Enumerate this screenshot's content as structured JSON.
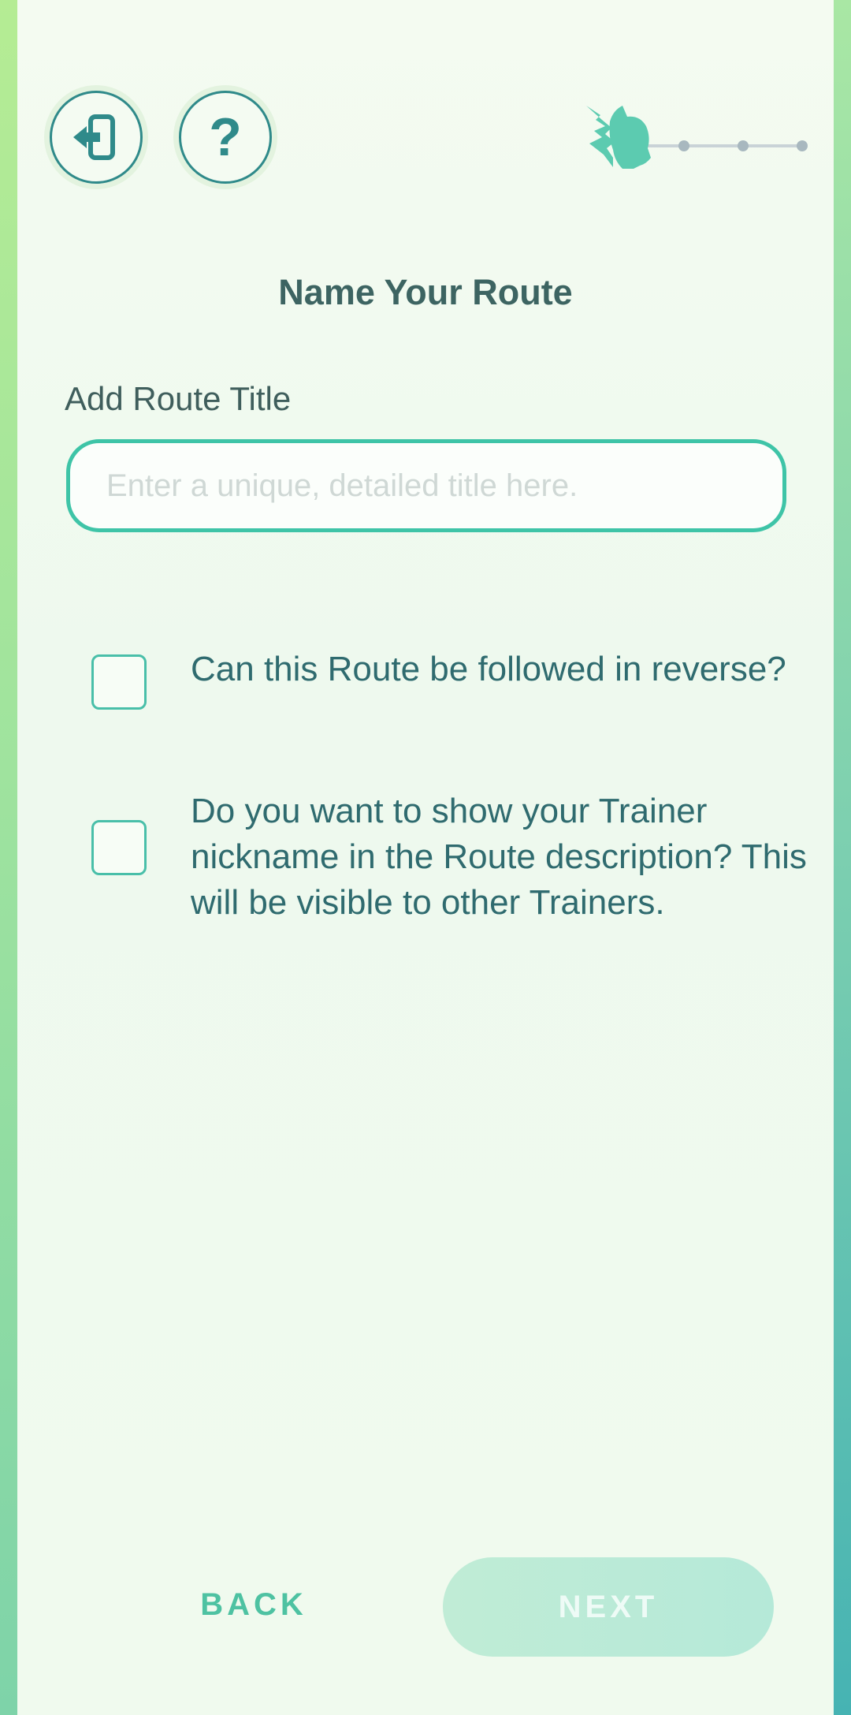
{
  "header": {
    "exit_icon": "exit-door-icon",
    "help_icon": "question-mark-icon",
    "help_label": "?",
    "progress": {
      "current_step": 1,
      "total_steps": 4,
      "marker_icon": "pikachu-silhouette-icon"
    }
  },
  "page": {
    "title": "Name Your Route"
  },
  "form": {
    "title_label": "Add Route Title",
    "title_value": "",
    "title_placeholder": "Enter a unique, detailed title here.",
    "options": [
      {
        "label": "Can this Route be followed in reverse?",
        "checked": false
      },
      {
        "label": "Do you want to show your Trainer nickname in the Route description? This will be visible to other Trainers.",
        "checked": false
      }
    ]
  },
  "footer": {
    "back_label": "BACK",
    "next_label": "NEXT",
    "next_enabled": false
  },
  "colors": {
    "accent": "#3ec4a7",
    "text": "#2f6b6f",
    "icon": "#2f8a8a"
  }
}
